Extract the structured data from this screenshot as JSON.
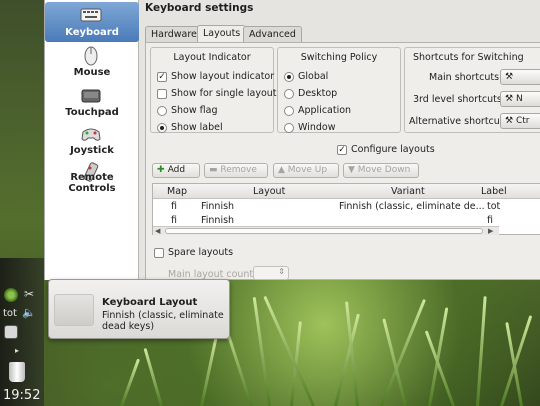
{
  "window": {
    "title": "Keyboard settings"
  },
  "sidebar": {
    "items": [
      {
        "label": "Keyboard",
        "icon": "keyboard-icon"
      },
      {
        "label": "Mouse",
        "icon": "mouse-icon"
      },
      {
        "label": "Touchpad",
        "icon": "touchpad-icon"
      },
      {
        "label": "Joystick",
        "icon": "joystick-icon"
      },
      {
        "label": "Remote Controls",
        "icon": "remote-control-icon"
      }
    ]
  },
  "tabs": [
    {
      "label": "Hardware"
    },
    {
      "label": "Layouts"
    },
    {
      "label": "Advanced"
    }
  ],
  "layout_indicator": {
    "title": "Layout Indicator",
    "show_layout_indicator": "Show layout indicator",
    "show_for_single_layout": "Show for single layout",
    "show_flag": "Show flag",
    "show_label": "Show label"
  },
  "switching_policy": {
    "title": "Switching Policy",
    "global": "Global",
    "desktop": "Desktop",
    "application": "Application",
    "window": "Window"
  },
  "shortcuts": {
    "title": "Shortcuts for Switching",
    "main_label": "Main shortcuts:",
    "main_value": "",
    "third_level_label": "3rd level shortcuts:",
    "third_level_value": "N",
    "alternative_label": "Alternative shortcut:",
    "alternative_value": "Ctr"
  },
  "configure_layouts": "Configure layouts",
  "toolbar": {
    "add": "Add",
    "remove": "Remove",
    "move_up": "Move Up",
    "move_down": "Move Down"
  },
  "table": {
    "headers": {
      "map": "Map",
      "layout": "Layout",
      "variant": "Variant",
      "label": "Label"
    },
    "rows": [
      {
        "map": "fi",
        "layout": "Finnish",
        "variant": "Finnish (classic, eliminate de...",
        "label": "tot"
      },
      {
        "map": "fi",
        "layout": "Finnish",
        "variant": "",
        "label": "fi"
      }
    ]
  },
  "spare_layouts": "Spare layouts",
  "main_layout_count": "Main layout count:",
  "popup": {
    "title": "Keyboard Layout",
    "body": "Finnish (classic, eliminate dead keys)"
  },
  "panel": {
    "layout_indicator": "tot",
    "clock": "19:52"
  },
  "colors": {
    "selection": "#4a7ab8",
    "window_bg": "#e6e4e0"
  }
}
